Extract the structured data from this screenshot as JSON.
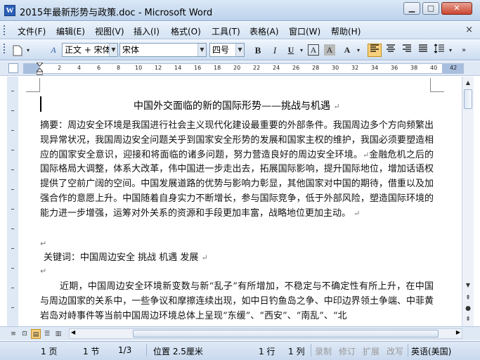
{
  "window": {
    "title": "2015年最新形势与政策.doc - Microsoft Word",
    "app_icon": "W",
    "minimize_icon": "minimize-icon",
    "maximize_icon": "maximize-icon",
    "close_icon": "close-icon"
  },
  "menu": {
    "items": [
      {
        "label": "文件(F)"
      },
      {
        "label": "编辑(E)"
      },
      {
        "label": "视图(V)"
      },
      {
        "label": "插入(I)"
      },
      {
        "label": "格式(O)"
      },
      {
        "label": "工具(T)"
      },
      {
        "label": "表格(A)"
      },
      {
        "label": "窗口(W)"
      },
      {
        "label": "帮助(H)"
      }
    ],
    "close_doc": "×"
  },
  "toolbar": {
    "style_value": "正文 + 宋体",
    "font_value": "宋体",
    "size_value": "四号",
    "bold": "B",
    "italic": "I",
    "underline": "U",
    "char_border": "A",
    "char_shading": "A",
    "highlight": "A",
    "style_icon": "A",
    "overflow": "»"
  },
  "ruler": {
    "ticks": [
      "2",
      "4",
      "6",
      "8",
      "10",
      "12",
      "14",
      "16",
      "18",
      "20",
      "22",
      "24",
      "26",
      "28",
      "30",
      "32",
      "34",
      "36",
      "38",
      "40",
      "42"
    ]
  },
  "document": {
    "title": "中国外交面临的新的国际形势——挑战与机遇",
    "abstract": "摘要：周边安全环境是我国进行社会主义现代化建设最重要的外部条件。我国周边多个方向频繁出现异常状况，我国周边安全问题关乎到国家安全形势的发展和国家主权的维护，我国必须要塑造相应的国家安全意识，迎接和将面临的诸多问题，努力营造良好的周边安全环境。",
    "para2": "金融危机之后的国际格局大调整，体系大改革，伟中国进一步走出去，拓展国际影响，提升国际地位，增加话语权提供了空前广阔的空间。中国发展道路的优势与影响力彰显，其他国家对中国的期待，借重以及加强合作的意愿上升。中国随着自身实力不断增长，参与国际竞争，低于外部风险，塑造国际环境的能力进一步增强，运筹对外关系的资源和手段更加丰富，战略地位更加主动。",
    "keywords": "关键词：中国周边安全 挑战   机遇   发展",
    "para3": "近期，中国周边安全环境新变数与新“乱子”有所增加，不稳定与不确定性有所上升，在中国与周边国家的关系中，一些争议和摩擦连续出现，如中日钓鱼岛之争、中印边界领土争端、中菲黄岩岛对峙事件等当前中国周边环境总体上呈现“东缓”、“西安”、“南乱”、“北",
    "para_mark": "↵"
  },
  "statusbar": {
    "page": "1 页",
    "section": "1 节",
    "page_of": "1/3",
    "position": "位置 2.5厘米",
    "line": "1 行",
    "column": "1 列",
    "rec": "录制",
    "trk": "修订",
    "ext": "扩展",
    "ovr": "改写",
    "language": "英语(美国)"
  }
}
